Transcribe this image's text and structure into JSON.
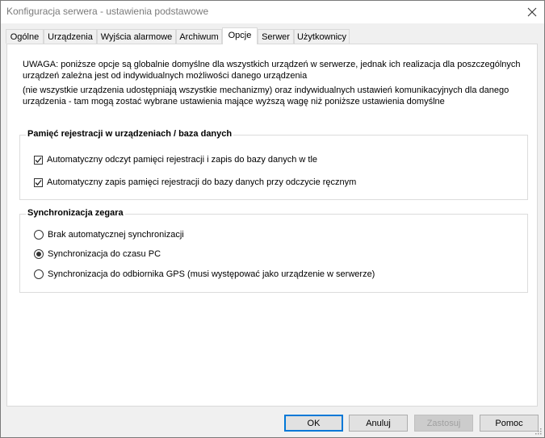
{
  "window": {
    "title": "Konfiguracja serwera - ustawienia podstawowe",
    "close_icon": "close-icon"
  },
  "tabs": [
    {
      "label": "Ogólne"
    },
    {
      "label": "Urządzenia"
    },
    {
      "label": "Wyjścia alarmowe"
    },
    {
      "label": "Archiwum"
    },
    {
      "label": "Opcje",
      "active": true
    },
    {
      "label": "Serwer"
    },
    {
      "label": "Użytkownicy"
    }
  ],
  "info": {
    "line1": "UWAGA: poniższe opcje są globalnie domyślne dla wszystkich urządzeń w serwerze, jednak ich realizacja dla poszczególnych urządzeń zależna jest od indywidualnych możliwości danego urządzenia",
    "line2": "(nie wszystkie urządzenia udostępniają wszystkie mechanizmy) oraz indywidualnych ustawień komunikacyjnych dla danego urządzenia - tam mogą zostać wybrane ustawienia mające wyższą wagę niż poniższe ustawienia domyślne"
  },
  "memory_group": {
    "title": "Pamięć rejestracji w urządzeniach / baza danych",
    "options": [
      {
        "label": "Automatyczny odczyt pamięci rejestracji i zapis do bazy danych w tle",
        "checked": true
      },
      {
        "label": "Automatyczny zapis pamięci rejestracji do bazy danych przy odczycie ręcznym",
        "checked": true
      }
    ]
  },
  "sync_group": {
    "title": "Synchronizacja zegara",
    "options": [
      {
        "label": "Brak automatycznej synchronizacji",
        "selected": false
      },
      {
        "label": "Synchronizacja do czasu PC",
        "selected": true
      },
      {
        "label": "Synchronizacja do odbiornika GPS (musi występować jako urządzenie w serwerze)",
        "selected": false
      }
    ]
  },
  "buttons": {
    "ok": "OK",
    "cancel": "Anuluj",
    "apply": "Zastosuj",
    "help": "Pomoc"
  },
  "colors": {
    "accent": "#0078d7",
    "background": "#f0f0f0",
    "panel": "#ffffff"
  }
}
